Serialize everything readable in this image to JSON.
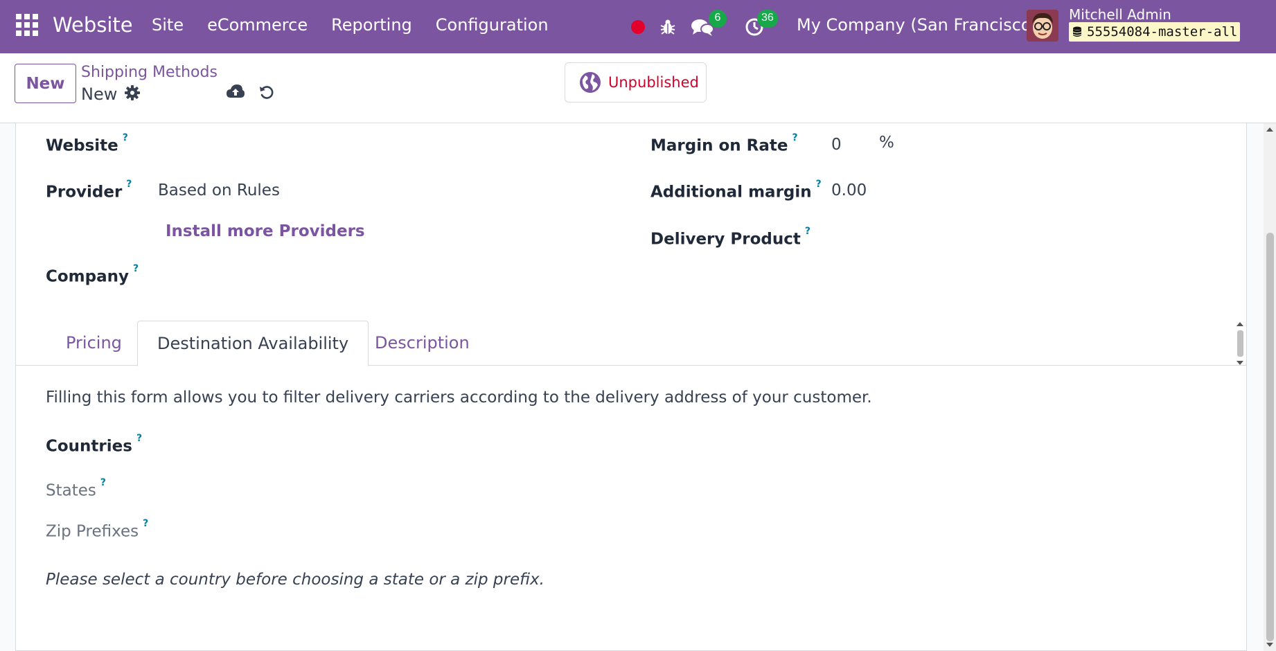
{
  "navbar": {
    "brand": "Website",
    "menu": [
      "Site",
      "eCommerce",
      "Reporting",
      "Configuration"
    ],
    "chat_count": "6",
    "activity_count": "36",
    "company": "My Company (San Francisco)",
    "user_name": "Mitchell Admin",
    "database": "55554084-master-all",
    "colors": {
      "bar": "#7c55a0",
      "badge": "#17a84a",
      "record": "#e3002b"
    }
  },
  "control": {
    "new_label": "New",
    "breadcrumb": "Shipping Methods",
    "record_name": "New",
    "publish_label": "Unpublished"
  },
  "form": {
    "website_label": "Website",
    "provider_label": "Provider",
    "provider_value": "Based on Rules",
    "install_link": "Install more Providers",
    "company_label": "Company",
    "margin_rate_label": "Margin on Rate",
    "margin_rate_value": "0",
    "margin_rate_unit": "%",
    "additional_margin_label": "Additional margin",
    "additional_margin_value": "0.00",
    "delivery_product_label": "Delivery Product",
    "help_marker": "?"
  },
  "tabs": [
    "Pricing",
    "Destination Availability",
    "Description"
  ],
  "destination": {
    "intro": "Filling this form allows you to filter delivery carriers according to the delivery address of your customer.",
    "countries_label": "Countries",
    "states_label": "States",
    "zip_label": "Zip Prefixes",
    "hint": "Please select a country before choosing a state or a zip prefix."
  }
}
